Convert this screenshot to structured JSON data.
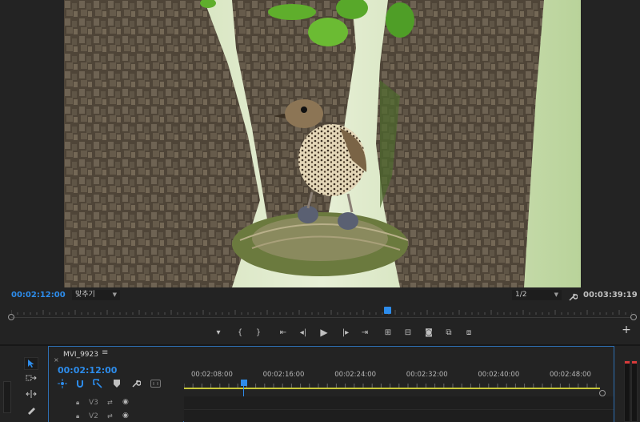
{
  "monitor": {
    "current_timecode": "00:02:12:00",
    "fit_select": "맞추기",
    "resolution_select": "1/2",
    "duration_timecode": "00:03:39:19",
    "scrub_position": 0.6
  },
  "transport": {
    "buttons": [
      {
        "icon": "add-marker-icon",
        "glyph": "▾"
      },
      {
        "icon": "mark-in-icon",
        "glyph": "{"
      },
      {
        "icon": "mark-out-icon",
        "glyph": "}"
      },
      {
        "icon": "go-to-in-icon",
        "glyph": "⇤"
      },
      {
        "icon": "step-back-icon",
        "glyph": "◂|"
      },
      {
        "icon": "play-icon",
        "glyph": "▶"
      },
      {
        "icon": "step-forward-icon",
        "glyph": "|▸"
      },
      {
        "icon": "go-to-out-icon",
        "glyph": "⇥"
      },
      {
        "icon": "lift-icon",
        "glyph": "⊞"
      },
      {
        "icon": "extract-icon",
        "glyph": "⊟"
      },
      {
        "icon": "export-frame-icon",
        "glyph": "◙"
      },
      {
        "icon": "compare-icon",
        "glyph": "⧉"
      },
      {
        "icon": "comparison-view-icon",
        "glyph": "⧈"
      }
    ],
    "add_label": "+"
  },
  "timeline": {
    "sequence_name": "MVI_9923",
    "close_glyph": "×",
    "menu_glyph": "≡",
    "timecode": "00:02:12:00",
    "ruler_labels": [
      "00:02:08:00",
      "00:02:16:00",
      "00:02:24:00",
      "00:02:32:00",
      "00:02:40:00",
      "00:02:48:00"
    ],
    "tracks": [
      {
        "name": "V3"
      },
      {
        "name": "V2"
      }
    ]
  },
  "colors": {
    "accent": "#2d8ceb",
    "panel_bg": "#232323",
    "work_area": "#c8c83a",
    "meter_peak": "#d83a3a"
  }
}
